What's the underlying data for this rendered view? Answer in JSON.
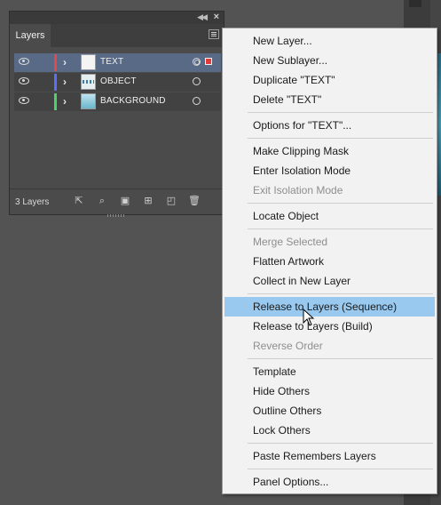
{
  "panel": {
    "tab_label": "Layers",
    "layer_count": "3 Layers",
    "layers": [
      {
        "name": "TEXT",
        "color": "#e8474a",
        "thumb": "white",
        "selected": true
      },
      {
        "name": "OBJECT",
        "color": "#5b6fff",
        "thumb": "obj",
        "selected": false
      },
      {
        "name": "BACKGROUND",
        "color": "#4cd26b",
        "thumb": "bg",
        "selected": false
      }
    ]
  },
  "menu": {
    "items": [
      {
        "label": "New Layer...",
        "state": "enabled"
      },
      {
        "label": "New Sublayer...",
        "state": "enabled"
      },
      {
        "label": "Duplicate \"TEXT\"",
        "state": "enabled"
      },
      {
        "label": "Delete \"TEXT\"",
        "state": "enabled"
      },
      {
        "label": "Options for \"TEXT\"...",
        "state": "enabled"
      },
      {
        "label": "Make Clipping Mask",
        "state": "enabled"
      },
      {
        "label": "Enter Isolation Mode",
        "state": "enabled"
      },
      {
        "label": "Exit Isolation Mode",
        "state": "disabled"
      },
      {
        "label": "Locate Object",
        "state": "enabled"
      },
      {
        "label": "Merge Selected",
        "state": "disabled"
      },
      {
        "label": "Flatten Artwork",
        "state": "enabled"
      },
      {
        "label": "Collect in New Layer",
        "state": "enabled"
      },
      {
        "label": "Release to Layers (Sequence)",
        "state": "hover"
      },
      {
        "label": "Release to Layers (Build)",
        "state": "enabled"
      },
      {
        "label": "Reverse Order",
        "state": "disabled"
      },
      {
        "label": "Template",
        "state": "enabled"
      },
      {
        "label": "Hide Others",
        "state": "enabled"
      },
      {
        "label": "Outline Others",
        "state": "enabled"
      },
      {
        "label": "Lock Others",
        "state": "enabled"
      },
      {
        "label": "Paste Remembers Layers",
        "state": "enabled"
      },
      {
        "label": "Panel Options...",
        "state": "enabled"
      }
    ]
  },
  "colors": {
    "hover_highlight": "#99c9ef",
    "selected_row": "#596a86",
    "selection_square": "#e23b3b"
  }
}
